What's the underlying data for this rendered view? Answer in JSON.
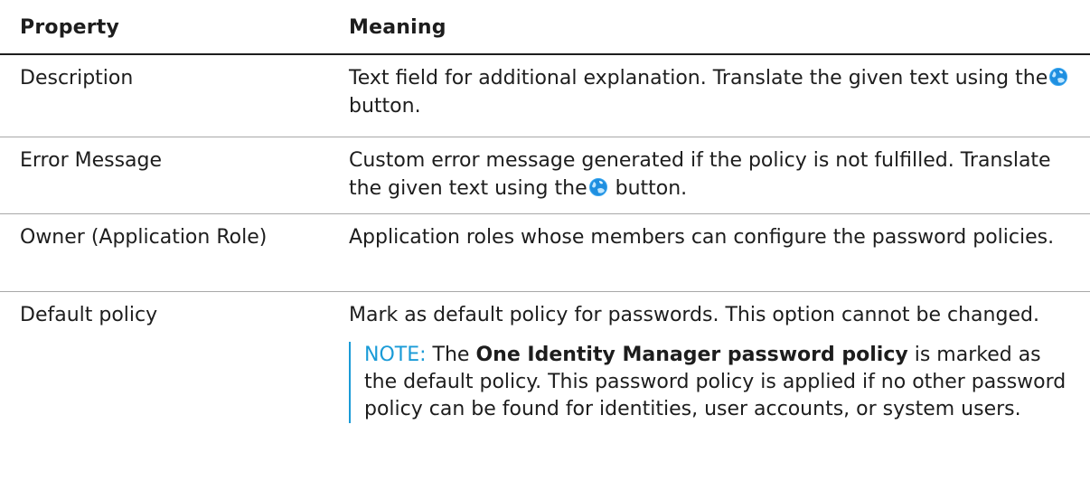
{
  "table": {
    "headers": {
      "property": "Property",
      "meaning": "Meaning"
    },
    "rows": [
      {
        "property": "Description",
        "meaning_line1": "Text field for additional explanation. Translate the given text",
        "meaning_pre_icon": "using the",
        "meaning_post_icon": "button."
      },
      {
        "property": "Error Message",
        "meaning_line1": "Custom error message generated if the policy is not fulfilled.",
        "meaning_pre_icon": "Translate the given text using the",
        "meaning_post_icon": "button."
      },
      {
        "property": "Owner (Application Role)",
        "meaning": "Application roles whose members can configure the password policies."
      },
      {
        "property": "Default policy",
        "meaning": "Mark as default policy for passwords. This option cannot be changed.",
        "note": {
          "label": "NOTE:",
          "text_before": "The",
          "strong": "One Identity Manager password policy",
          "text_after": "is marked as the default policy. This password policy is applied if no other password policy can be found for identities, user accounts, or system users."
        }
      }
    ]
  },
  "icons": {
    "translate": "globe-translate-icon"
  },
  "colors": {
    "note_accent": "#1a9bd7",
    "icon_blue": "#1f8fe0"
  }
}
